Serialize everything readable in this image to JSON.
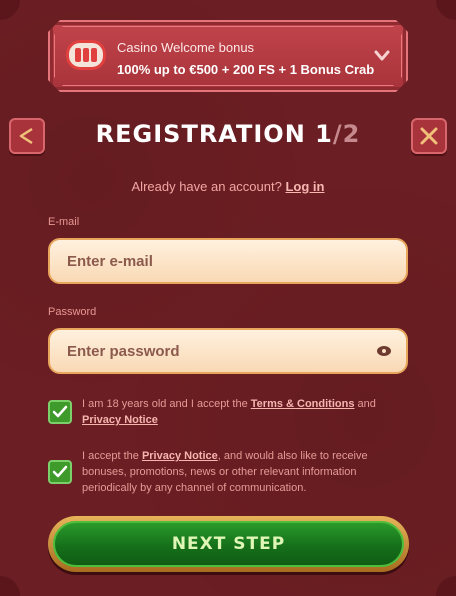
{
  "bonus": {
    "title": "Casino Welcome bonus",
    "description": "100% up to €500 + 200 FS + 1 Bonus Crab",
    "icon": "slot-machine-icon"
  },
  "header": {
    "title_main": "REGISTRATION 1",
    "title_sep": "/2"
  },
  "login": {
    "prompt": "Already have an account?",
    "link": "Log in"
  },
  "form": {
    "email_label": "E-mail",
    "email_placeholder": "Enter e-mail",
    "password_label": "Password",
    "password_placeholder": "Enter password"
  },
  "consents": {
    "age_text_1": "I am 18 years old and I accept the ",
    "age_link_terms": "Terms & Conditions",
    "age_text_2": " and",
    "age_link_privacy": "Privacy Notice",
    "age_checked": true,
    "marketing_text_1": "I accept the ",
    "marketing_link_privacy": "Privacy Notice",
    "marketing_text_2": ", and would also like to receive bonuses, promotions, news or other relevant information periodically by any channel of communication.",
    "marketing_checked": true
  },
  "actions": {
    "next_label": "NEXT STEP"
  },
  "colors": {
    "background": "#6b1e23",
    "banner": "#b43b42",
    "field": "#fbe3c6",
    "accent_green": "#1f8a22",
    "gold": "#e0a24d"
  }
}
